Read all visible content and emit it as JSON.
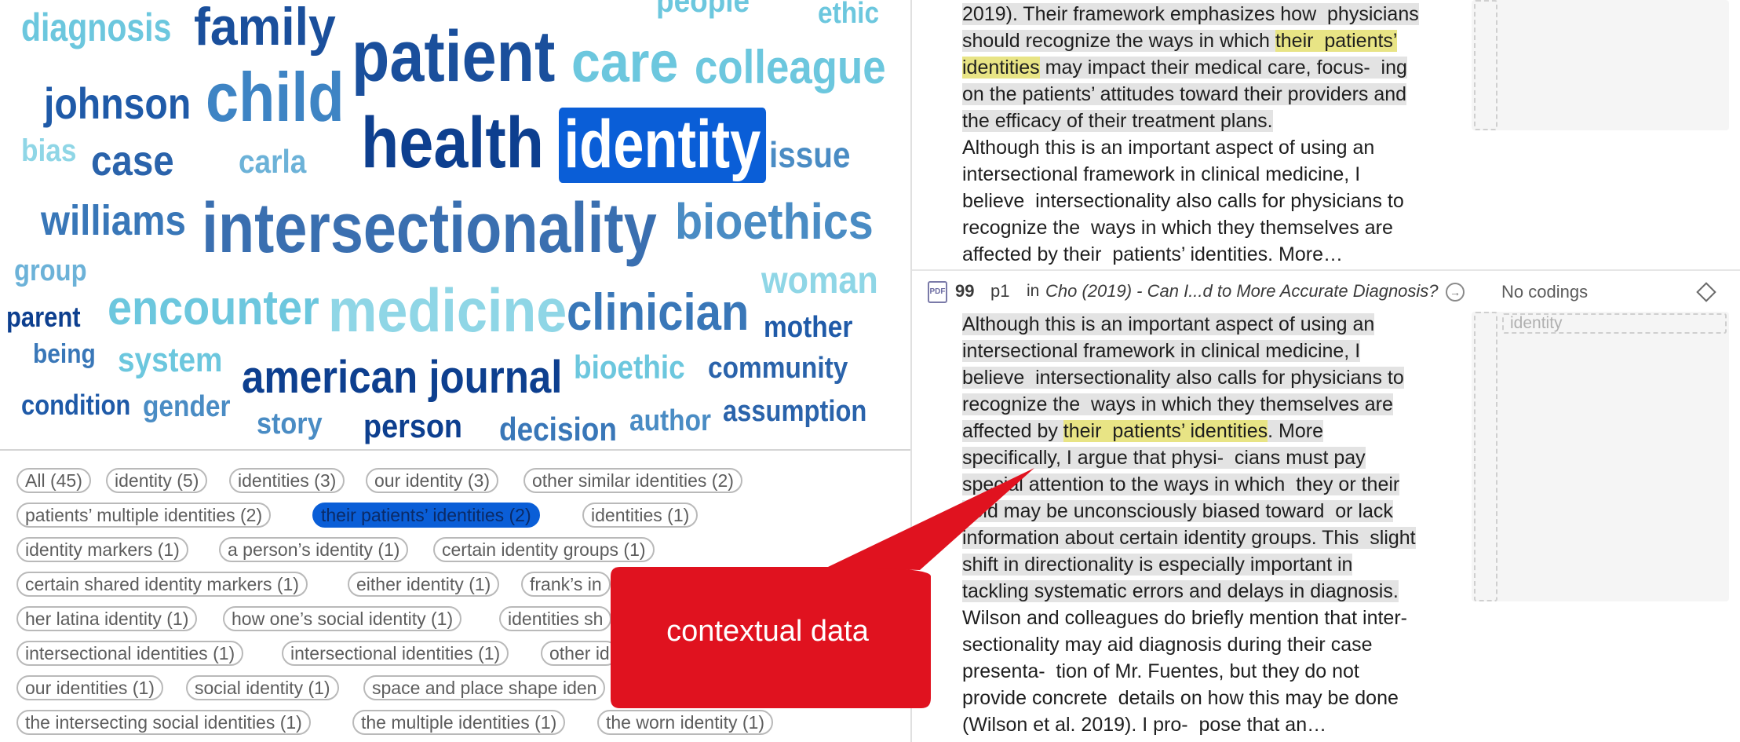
{
  "word_cloud": {
    "words": [
      {
        "text": "diagnosis",
        "color": "#6cc7de"
      },
      {
        "text": "family",
        "color": "#1a4f9c"
      },
      {
        "text": "people",
        "color": "#6cc7de"
      },
      {
        "text": "ethic",
        "color": "#6cc7de"
      },
      {
        "text": "patient",
        "color": "#1a4f9c"
      },
      {
        "text": "care",
        "color": "#6cc7de"
      },
      {
        "text": "colleague",
        "color": "#6cc7de"
      },
      {
        "text": "johnson",
        "color": "#1f5aa8"
      },
      {
        "text": "child",
        "color": "#3e84c4"
      },
      {
        "text": "bias",
        "color": "#8fd6e6"
      },
      {
        "text": "case",
        "color": "#2a63ab"
      },
      {
        "text": "carla",
        "color": "#6cb2d8"
      },
      {
        "text": "health",
        "color": "#0d3f8f"
      },
      {
        "text": "identity",
        "color": "#ffffff",
        "selected": true
      },
      {
        "text": "issue",
        "color": "#4a8cc4"
      },
      {
        "text": "williams",
        "color": "#3977b8"
      },
      {
        "text": "intersectionality",
        "color": "#3a6fb0"
      },
      {
        "text": "bioethics",
        "color": "#4a8cc4"
      },
      {
        "text": "group",
        "color": "#6cb2d8"
      },
      {
        "text": "woman",
        "color": "#8fd6e6"
      },
      {
        "text": "encounter",
        "color": "#6cc7de"
      },
      {
        "text": "medicine",
        "color": "#8fd6e6"
      },
      {
        "text": "clinician",
        "color": "#3977b8"
      },
      {
        "text": "parent",
        "color": "#0d3f8f"
      },
      {
        "text": "mother",
        "color": "#1f5aa8"
      },
      {
        "text": "being",
        "color": "#3977b8"
      },
      {
        "text": "system",
        "color": "#6cc7de"
      },
      {
        "text": "american journal",
        "color": "#0d3f8f"
      },
      {
        "text": "bioethic",
        "color": "#6cc7de"
      },
      {
        "text": "community",
        "color": "#2a63ab"
      },
      {
        "text": "condition",
        "color": "#1f5aa8"
      },
      {
        "text": "gender",
        "color": "#4a8cc4"
      },
      {
        "text": "story",
        "color": "#4a8cc4"
      },
      {
        "text": "person",
        "color": "#0d3f8f"
      },
      {
        "text": "decision",
        "color": "#3977b8"
      },
      {
        "text": "author",
        "color": "#4a8cc4"
      },
      {
        "text": "assumption",
        "color": "#2a63ab"
      }
    ]
  },
  "chips": [
    {
      "label": "All (45)"
    },
    {
      "label": "identity (5)"
    },
    {
      "label": "identities (3)"
    },
    {
      "label": "our identity (3)"
    },
    {
      "label": "other similar identities (2)"
    },
    {
      "label": "patients’ multiple identities (2)"
    },
    {
      "label": "their  patients’ identities (2)",
      "active": true
    },
    {
      "label": "identities (1)"
    },
    {
      "label": "identity markers (1)"
    },
    {
      "label": "a person’s identity (1)"
    },
    {
      "label": "certain identity groups (1)"
    },
    {
      "label": "certain shared identity markers (1)"
    },
    {
      "label": "either identity (1)"
    },
    {
      "label": "frank’s in"
    },
    {
      "label": "her latina identity (1)"
    },
    {
      "label": "how one’s  social identity (1)"
    },
    {
      "label": "identities sh"
    },
    {
      "label": "intersectional  identities (1)"
    },
    {
      "label": "intersectional identities (1)"
    },
    {
      "label": "other id"
    },
    {
      "label": "our identities (1)"
    },
    {
      "label": "social identity (1)"
    },
    {
      "label": "space and place shape iden"
    },
    {
      "label": "the intersecting social identities (1)"
    },
    {
      "label": "the multiple identities (1)"
    },
    {
      "label": "the worn identity (1)"
    }
  ],
  "entry_top": {
    "lines": [
      [
        {
          "t": "2019). Their framework emphasizes how  physicians",
          "h": "gray"
        }
      ],
      [
        {
          "t": "should recognize the ways in which ",
          "h": "gray"
        },
        {
          "t": "their  patients’",
          "h": "yellow"
        }
      ],
      [
        {
          "t": "identities",
          "h": "yellow"
        },
        {
          "t": " may impact their medical care, focus-  ing",
          "h": "gray"
        }
      ],
      [
        {
          "t": "on the patients’ attitudes toward their providers and",
          "h": "gray"
        }
      ],
      [
        {
          "t": "the efficacy of their treatment plans.",
          "h": "gray"
        }
      ],
      [
        {
          "t": "Although this is an important aspect of using an",
          "h": ""
        }
      ],
      [
        {
          "t": "intersectional framework in clinical medicine, I",
          "h": ""
        }
      ],
      [
        {
          "t": "believe  intersectionality also calls for physicians to",
          "h": ""
        }
      ],
      [
        {
          "t": "recognize the  ways in which they themselves are",
          "h": ""
        }
      ],
      [
        {
          "t": "affected by their  patients’ identities. ",
          "h": ""
        },
        {
          "t": "More…",
          "h": "link"
        }
      ]
    ]
  },
  "entry_header": {
    "icon_label": "PDF",
    "number": "99",
    "page": "p1",
    "in_word": "in",
    "document": "Cho (2019) - Can I...d to More Accurate Diagnosis?",
    "codings_label": "No codings"
  },
  "entry_bottom": {
    "coding_tag": "identity",
    "lines": [
      [
        {
          "t": "Although this is an important aspect of using an",
          "h": "gray"
        }
      ],
      [
        {
          "t": "intersectional framework in clinical medicine, I",
          "h": "gray"
        }
      ],
      [
        {
          "t": "believe  intersectionality also calls for physicians to",
          "h": "gray"
        }
      ],
      [
        {
          "t": "recognize the  ways in which they themselves are",
          "h": "gray"
        }
      ],
      [
        {
          "t": "affected by ",
          "h": "gray"
        },
        {
          "t": "their  patients’ identities",
          "h": "yellow"
        },
        {
          "t": ". More",
          "h": "gray"
        }
      ],
      [
        {
          "t": "specifically, I argue that physi-  cians must pay",
          "h": "gray"
        }
      ],
      [
        {
          "t": "special attention to the ways in which  they or their",
          "h": "gray"
        }
      ],
      [
        {
          "t": "field may be unconsciously biased toward  or lack",
          "h": "gray"
        }
      ],
      [
        {
          "t": "information about certain identity groups. This  slight",
          "h": "gray"
        }
      ],
      [
        {
          "t": "shift in directionality is especially important in",
          "h": "gray"
        }
      ],
      [
        {
          "t": "tackling systematic errors and delays in diagnosis.",
          "h": "gray"
        }
      ],
      [
        {
          "t": "Wilson and colleagues do briefly mention that inter-",
          "h": ""
        }
      ],
      [
        {
          "t": "sectionality may aid diagnosis during their case",
          "h": ""
        }
      ],
      [
        {
          "t": "presenta-  tion of Mr. Fuentes, but they do not",
          "h": ""
        }
      ],
      [
        {
          "t": "provide concrete  details on how this may be done",
          "h": ""
        }
      ],
      [
        {
          "t": "(Wilson et al. 2019). I pro-  pose that an…",
          "h": ""
        }
      ]
    ]
  },
  "callout": {
    "text": "contextual data",
    "color": "#e0121f"
  }
}
